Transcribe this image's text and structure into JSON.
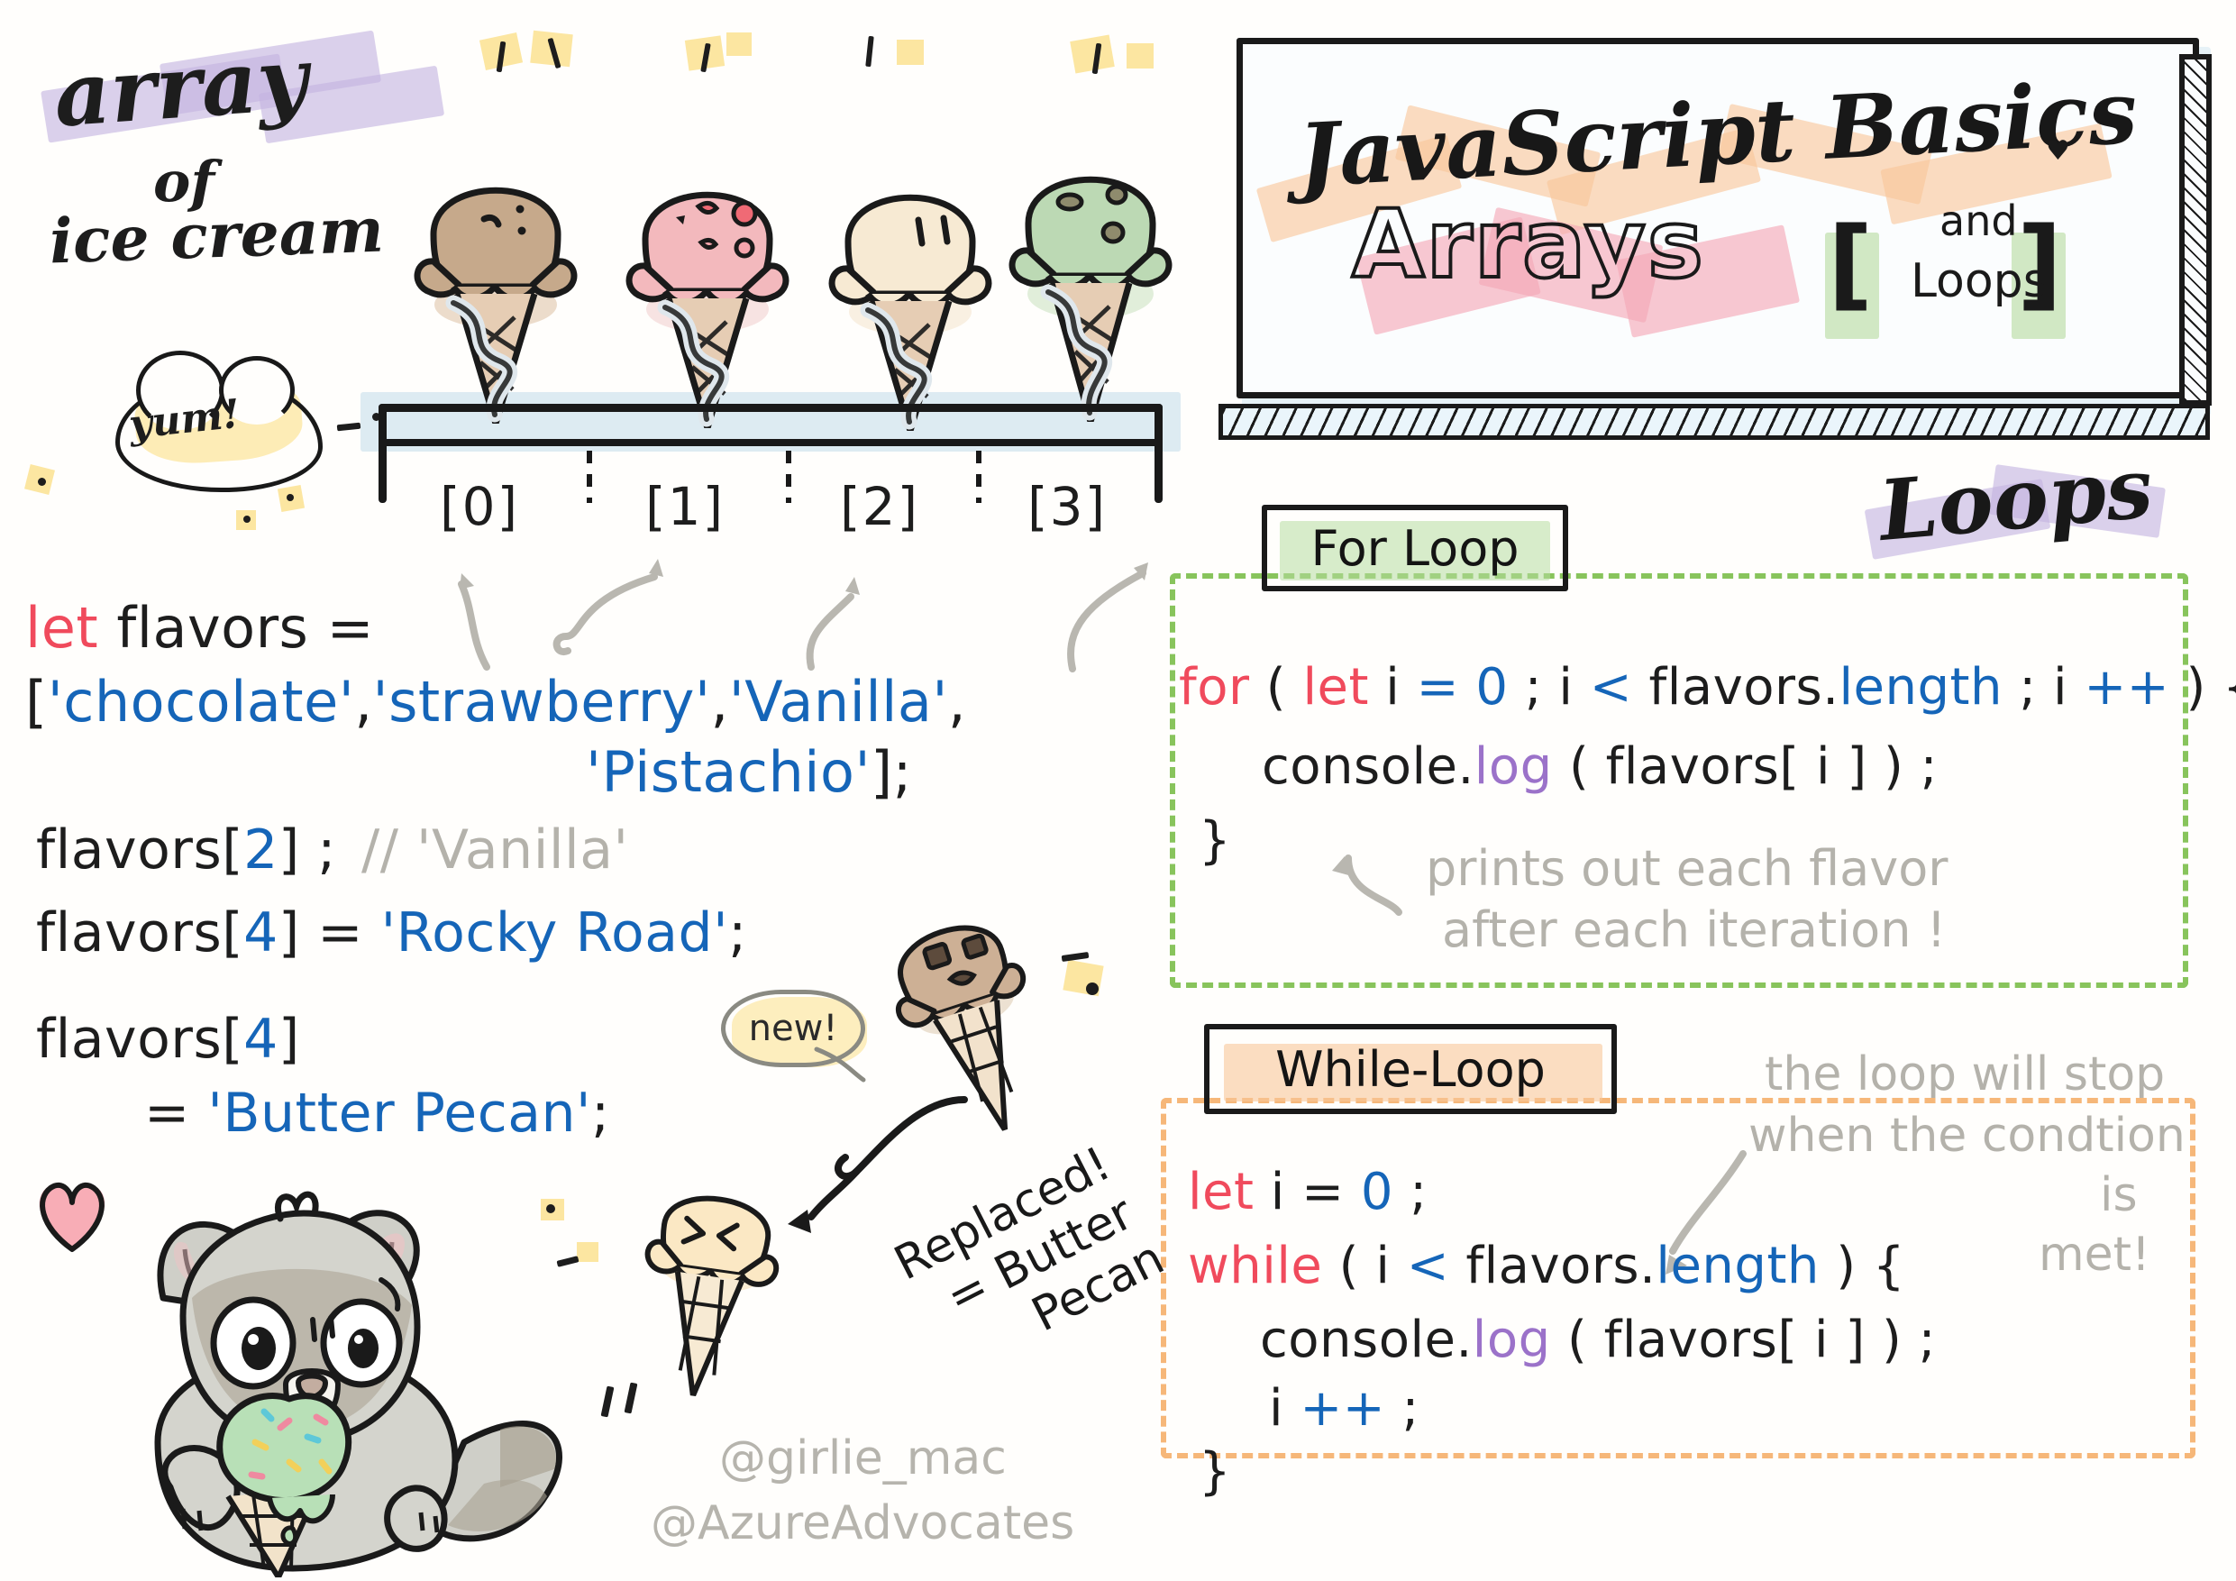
{
  "sheet": {
    "background": "#fffefc",
    "ink": "#1d1d1d"
  },
  "palette": {
    "keyword_red": "#f04a5c",
    "string_blue": "#1565b8",
    "method_purple": "#9b72c9",
    "comment_gray": "#b4b2ab",
    "highlight_purple": "#c4b3e0",
    "highlight_yellow": "#fbe08a",
    "highlight_peach": "#f8c79a",
    "highlight_pink": "#f4a7b4",
    "highlight_green": "#b7dca0",
    "highlight_blue": "#bcd8e8",
    "for_loop_dash": "#88c45c",
    "while_loop_dash": "#f6b779"
  },
  "left_panel": {
    "title_line1": "array",
    "title_line2": "of",
    "title_line3": "ice cream",
    "yum_bubble": "yum!",
    "index_labels": [
      "[0]",
      "[1]",
      "[2]",
      "[3]"
    ],
    "cones": [
      {
        "index": 0,
        "flavor": "chocolate",
        "scoop_color": "#c6a98b",
        "face": "happy"
      },
      {
        "index": 1,
        "flavor": "strawberry",
        "scoop_color": "#f3b9bd",
        "face": "happy"
      },
      {
        "index": 2,
        "flavor": "vanilla",
        "scoop_color": "#f7ead3",
        "face": "happy"
      },
      {
        "index": 3,
        "flavor": "pistachio",
        "scoop_color": "#bcd9b4",
        "face": "happy"
      }
    ],
    "code": {
      "line1": {
        "kw": "let",
        "rest": " flavors ="
      },
      "line2_open": "[",
      "line2_strings": [
        "'chocolate'",
        "'strawberry'",
        "'Vanilla'"
      ],
      "line3_strings": [
        "'Pistachio'"
      ],
      "line3_close": "];",
      "line4_expr": "flavors[",
      "line4_index": "2",
      "line4_tail": "] ;",
      "line4_comment": "// 'Vanilla'",
      "line5_expr": "flavors[",
      "line5_index": "4",
      "line5_tail": "] = ",
      "line5_value": "'Rocky Road'",
      "line5_semi": ";",
      "line6_expr": "flavors[",
      "line6_index": "4",
      "line6_tail": "]",
      "line7_eq": "= ",
      "line7_value": "'Butter Pecan'",
      "line7_semi": ";"
    },
    "new_badge": "new!",
    "replaced_note_line1": "Replaced!",
    "replaced_note_line2": "= Butter",
    "replaced_note_line3": "Pecan",
    "mascot": "raccoon-eating-mint-chip-ice-cream"
  },
  "banner": {
    "title_script": "JavaScript Basics",
    "title_big": "Arrays",
    "bracket_open": "[",
    "bracket_close": "]",
    "sub_and": "and",
    "sub_loops": "Loops",
    "heart": "♥"
  },
  "right_panel": {
    "section_title": "Loops",
    "for_loop": {
      "label": "For Loop",
      "code_lines": [
        [
          {
            "t": "for",
            "c": "red"
          },
          {
            "t": " ( ",
            "c": "black"
          },
          {
            "t": "let",
            "c": "red"
          },
          {
            "t": " i ",
            "c": "black"
          },
          {
            "t": "= 0",
            "c": "blue"
          },
          {
            "t": " ; i ",
            "c": "black"
          },
          {
            "t": "<",
            "c": "blue"
          },
          {
            "t": " flavors.",
            "c": "black"
          },
          {
            "t": "length",
            "c": "blue"
          },
          {
            "t": " ; i ",
            "c": "black"
          },
          {
            "t": "++",
            "c": "blue"
          },
          {
            "t": " ) {",
            "c": "black"
          }
        ],
        [
          {
            "t": "console.",
            "c": "black"
          },
          {
            "t": "log",
            "c": "purple"
          },
          {
            "t": " ( flavors[ i ] ) ;",
            "c": "black"
          }
        ],
        [
          {
            "t": "}",
            "c": "black"
          }
        ]
      ],
      "annotation_line1": "prints out each flavor",
      "annotation_line2": "after each iteration !"
    },
    "while_loop": {
      "label": "While-Loop",
      "code_lines": [
        [
          {
            "t": "let",
            "c": "red"
          },
          {
            "t": " i = ",
            "c": "black"
          },
          {
            "t": "0",
            "c": "blue"
          },
          {
            "t": " ;",
            "c": "black"
          }
        ],
        [
          {
            "t": "while",
            "c": "red"
          },
          {
            "t": " ( i ",
            "c": "black"
          },
          {
            "t": "<",
            "c": "blue"
          },
          {
            "t": " flavors.",
            "c": "black"
          },
          {
            "t": "length",
            "c": "blue"
          },
          {
            "t": " ) {",
            "c": "black"
          }
        ],
        [
          {
            "t": "console.",
            "c": "black"
          },
          {
            "t": "log",
            "c": "purple"
          },
          {
            "t": " ( flavors[ i ] ) ;",
            "c": "black"
          }
        ],
        [
          {
            "t": " i ",
            "c": "black"
          },
          {
            "t": "++",
            "c": "blue"
          },
          {
            "t": " ;",
            "c": "black"
          }
        ],
        [
          {
            "t": "}",
            "c": "black"
          }
        ]
      ],
      "annotation_line1": "the loop will stop",
      "annotation_line2": "when the condtion",
      "annotation_line3": "is",
      "annotation_line4": "met!"
    }
  },
  "credits": {
    "handle_1": "@girlie_mac",
    "handle_2": "@AzureAdvocates"
  }
}
